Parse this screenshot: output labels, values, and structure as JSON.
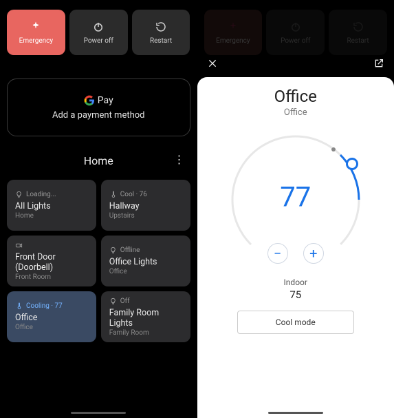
{
  "topButtons": [
    {
      "label": "Emergency",
      "icon": "emergency"
    },
    {
      "label": "Power off",
      "icon": "power"
    },
    {
      "label": "Restart",
      "icon": "restart"
    }
  ],
  "pay": {
    "brand_pay": "Pay",
    "subtitle": "Add a payment method"
  },
  "home": {
    "title": "Home"
  },
  "tiles": [
    {
      "status": "Loading...",
      "name": "All Lights",
      "room": "Home",
      "icon": "bulb"
    },
    {
      "status": "Cool · 76",
      "name": "Hallway",
      "room": "Upstairs",
      "icon": "thermo"
    },
    {
      "status": "",
      "name": "Front Door (Doorbell)",
      "room": "Front Room",
      "icon": "camera"
    },
    {
      "status": "Offline",
      "name": "Office Lights",
      "room": "Office",
      "icon": "bulb"
    },
    {
      "status": "Cooling · 77",
      "name": "Office",
      "room": "Office",
      "icon": "thermo",
      "active": true
    },
    {
      "status": "Off",
      "name": "Family Room Lights",
      "room": "Family Room",
      "icon": "bulb"
    }
  ],
  "thermostat": {
    "title": "Office",
    "room": "Office",
    "setpoint": "77",
    "indoor_label": "Indoor",
    "indoor_value": "75",
    "mode_button": "Cool mode"
  }
}
